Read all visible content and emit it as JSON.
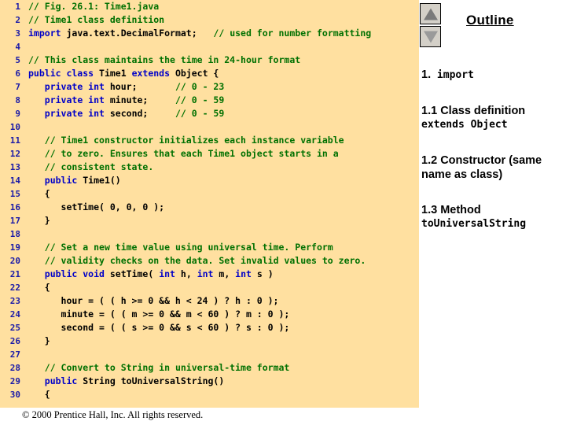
{
  "slide": {
    "footer": "© 2000 Prentice Hall, Inc.  All rights reserved."
  },
  "code_panel": {
    "background_color": "#ffe0a0",
    "line_number_color": "#1a1aa8",
    "comment_color": "#007000",
    "keyword_color": "#0000c8",
    "lines": [
      {
        "n": "1",
        "segments": [
          {
            "t": "// Fig. 26.1: Time1.java",
            "c": "cmt"
          }
        ]
      },
      {
        "n": "2",
        "segments": [
          {
            "t": "// Time1 class definition",
            "c": "cmt"
          }
        ]
      },
      {
        "n": "3",
        "segments": [
          {
            "t": "import",
            "c": "kw"
          },
          {
            "t": " java.text.DecimalFormat;   ",
            "c": "pl"
          },
          {
            "t": "// used for number formatting",
            "c": "cmt"
          }
        ]
      },
      {
        "n": "4",
        "segments": [
          {
            "t": "",
            "c": "pl"
          }
        ]
      },
      {
        "n": "5",
        "segments": [
          {
            "t": "// This class maintains the time in 24-hour format",
            "c": "cmt"
          }
        ]
      },
      {
        "n": "6",
        "segments": [
          {
            "t": "public class",
            "c": "kw"
          },
          {
            "t": " Time1 ",
            "c": "pl"
          },
          {
            "t": "extends",
            "c": "kw"
          },
          {
            "t": " Object {",
            "c": "pl"
          }
        ]
      },
      {
        "n": "7",
        "segments": [
          {
            "t": "   ",
            "c": "pl"
          },
          {
            "t": "private int",
            "c": "kw"
          },
          {
            "t": " hour;       ",
            "c": "pl"
          },
          {
            "t": "// 0 - 23",
            "c": "cmt"
          }
        ]
      },
      {
        "n": "8",
        "segments": [
          {
            "t": "   ",
            "c": "pl"
          },
          {
            "t": "private int",
            "c": "kw"
          },
          {
            "t": " minute;     ",
            "c": "pl"
          },
          {
            "t": "// 0 - 59",
            "c": "cmt"
          }
        ]
      },
      {
        "n": "9",
        "segments": [
          {
            "t": "   ",
            "c": "pl"
          },
          {
            "t": "private int",
            "c": "kw"
          },
          {
            "t": " second;     ",
            "c": "pl"
          },
          {
            "t": "// 0 - 59",
            "c": "cmt"
          }
        ]
      },
      {
        "n": "10",
        "segments": [
          {
            "t": "",
            "c": "pl"
          }
        ]
      },
      {
        "n": "11",
        "segments": [
          {
            "t": "   ",
            "c": "pl"
          },
          {
            "t": "// Time1 constructor initializes each instance variable",
            "c": "cmt"
          }
        ]
      },
      {
        "n": "12",
        "segments": [
          {
            "t": "   ",
            "c": "pl"
          },
          {
            "t": "// to zero. Ensures that each Time1 object starts in a",
            "c": "cmt"
          }
        ]
      },
      {
        "n": "13",
        "segments": [
          {
            "t": "   ",
            "c": "pl"
          },
          {
            "t": "// consistent state.",
            "c": "cmt"
          }
        ]
      },
      {
        "n": "14",
        "segments": [
          {
            "t": "   ",
            "c": "pl"
          },
          {
            "t": "public",
            "c": "kw"
          },
          {
            "t": " Time1()",
            "c": "pl"
          }
        ]
      },
      {
        "n": "15",
        "segments": [
          {
            "t": "   {",
            "c": "pl"
          }
        ]
      },
      {
        "n": "16",
        "segments": [
          {
            "t": "      setTime( 0, 0, 0 );",
            "c": "pl"
          }
        ]
      },
      {
        "n": "17",
        "segments": [
          {
            "t": "   }",
            "c": "pl"
          }
        ]
      },
      {
        "n": "18",
        "segments": [
          {
            "t": "",
            "c": "pl"
          }
        ]
      },
      {
        "n": "19",
        "segments": [
          {
            "t": "   ",
            "c": "pl"
          },
          {
            "t": "// Set a new time value using universal time. Perform",
            "c": "cmt"
          }
        ]
      },
      {
        "n": "20",
        "segments": [
          {
            "t": "   ",
            "c": "pl"
          },
          {
            "t": "// validity checks on the data. Set invalid values to zero.",
            "c": "cmt"
          }
        ]
      },
      {
        "n": "21",
        "segments": [
          {
            "t": "   ",
            "c": "pl"
          },
          {
            "t": "public void",
            "c": "kw"
          },
          {
            "t": " setTime( ",
            "c": "pl"
          },
          {
            "t": "int",
            "c": "kw"
          },
          {
            "t": " h, ",
            "c": "pl"
          },
          {
            "t": "int",
            "c": "kw"
          },
          {
            "t": " m, ",
            "c": "pl"
          },
          {
            "t": "int",
            "c": "kw"
          },
          {
            "t": " s )",
            "c": "pl"
          }
        ]
      },
      {
        "n": "22",
        "segments": [
          {
            "t": "   {",
            "c": "pl"
          }
        ]
      },
      {
        "n": "23",
        "segments": [
          {
            "t": "      hour = ( ( h >= 0 && h < 24 ) ? h : 0 );",
            "c": "pl"
          }
        ]
      },
      {
        "n": "24",
        "segments": [
          {
            "t": "      minute = ( ( m >= 0 && m < 60 ) ? m : 0 );",
            "c": "pl"
          }
        ]
      },
      {
        "n": "25",
        "segments": [
          {
            "t": "      second = ( ( s >= 0 && s < 60 ) ? s : 0 );",
            "c": "pl"
          }
        ]
      },
      {
        "n": "26",
        "segments": [
          {
            "t": "   }",
            "c": "pl"
          }
        ]
      },
      {
        "n": "27",
        "segments": [
          {
            "t": "",
            "c": "pl"
          }
        ]
      },
      {
        "n": "28",
        "segments": [
          {
            "t": "   ",
            "c": "pl"
          },
          {
            "t": "// Convert to String in universal-time format",
            "c": "cmt"
          }
        ]
      },
      {
        "n": "29",
        "segments": [
          {
            "t": "   ",
            "c": "pl"
          },
          {
            "t": "public",
            "c": "kw"
          },
          {
            "t": " String toUniversalString()",
            "c": "pl"
          }
        ]
      },
      {
        "n": "30",
        "segments": [
          {
            "t": "   {",
            "c": "pl"
          }
        ]
      }
    ]
  },
  "outline": {
    "title": "Outline",
    "scroll_up_icon": "triangle-up-icon",
    "scroll_down_icon": "triangle-down-icon",
    "items": [
      {
        "number": "1.",
        "heading": " import",
        "heading_style": "mono",
        "sub": ""
      },
      {
        "number": "1.1",
        "heading": " Class definition",
        "heading_style": "sans",
        "sub": "extends Object"
      },
      {
        "number": "1.2",
        "heading": " Constructor (same name as class)",
        "heading_style": "sans",
        "sub": ""
      },
      {
        "number": "1.3",
        "heading": " Method",
        "heading_style": "sans",
        "sub": "toUniversalString"
      }
    ]
  }
}
